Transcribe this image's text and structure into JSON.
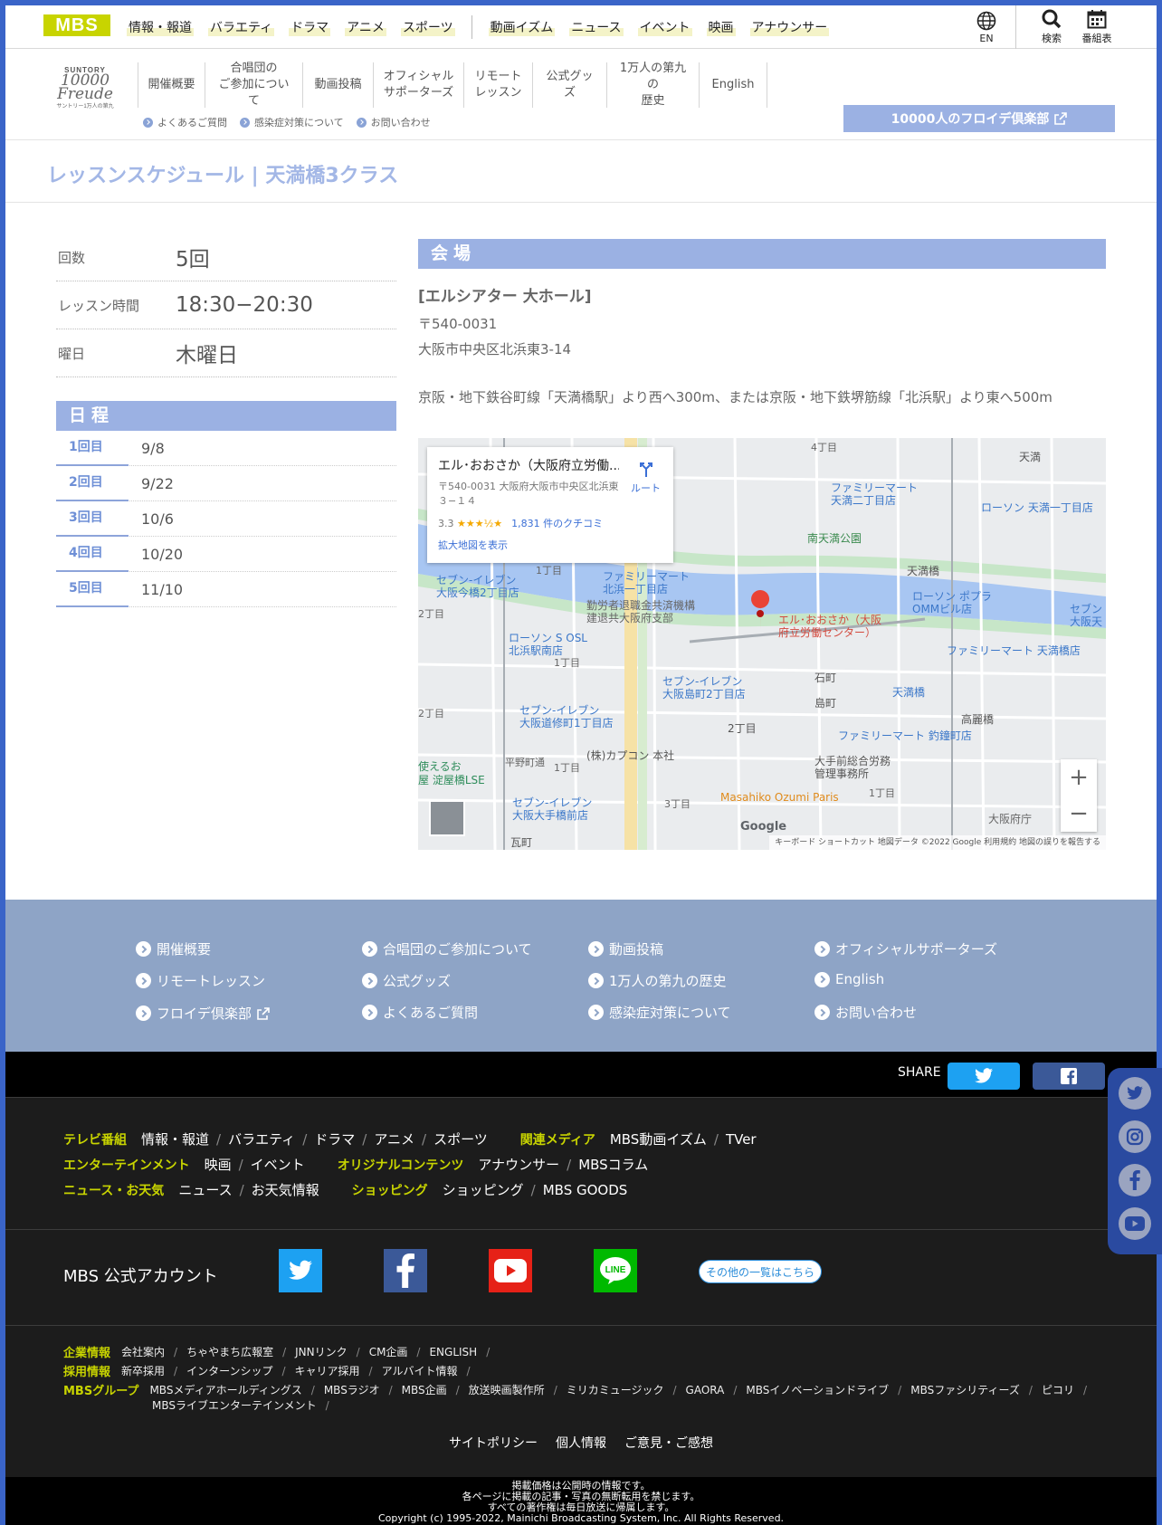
{
  "mbs_bar": {
    "logo": "MBS",
    "nav_group1": [
      "情報・報道",
      "バラエティ",
      "ドラマ",
      "アニメ",
      "スポーツ"
    ],
    "nav_group2": [
      "動画イズム",
      "ニュース",
      "イベント",
      "映画",
      "アナウンサー"
    ],
    "utilities": {
      "lang": "EN",
      "search": "検索",
      "schedule": "番組表"
    }
  },
  "freude_header": {
    "logo_brand": "SUNTORY",
    "logo_name": "10000 Freude",
    "logo_sub": "サントリー1万人の第九",
    "nav": [
      "開催概要",
      "合唱団の\nご参加について",
      "動画投稿",
      "オフィシャル\nサポーターズ",
      "リモート\nレッスン",
      "公式グッズ",
      "1万人の第九の\n歴史",
      "English"
    ],
    "sub_links": [
      "よくあるご質問",
      "感染症対策について",
      "お問い合わせ"
    ],
    "club_button": "10000人のフロイデ倶楽部"
  },
  "page_title": "レッスンスケジュール | 天満橋3クラス",
  "lesson_info": [
    {
      "label": "回数",
      "value": "5回"
    },
    {
      "label": "レッスン時間",
      "value": "18:30−20:30"
    },
    {
      "label": "曜日",
      "value": "木曜日"
    }
  ],
  "schedule": {
    "heading": "日程",
    "rows": [
      {
        "n": "1回目",
        "date": "9/8"
      },
      {
        "n": "2回目",
        "date": "9/22"
      },
      {
        "n": "3回目",
        "date": "10/6"
      },
      {
        "n": "4回目",
        "date": "10/20"
      },
      {
        "n": "5回目",
        "date": "11/10"
      }
    ]
  },
  "venue": {
    "heading": "会場",
    "name": "[エルシアター 大ホール]",
    "postal": "〒540-0031",
    "address": "大阪市中央区北浜東3-14",
    "access": "京阪・地下鉄谷町線「天満橋駅」より西へ300m、または京阪・地下鉄堺筋線「北浜駅」より東へ500m"
  },
  "map": {
    "card_title": "エル･おおさか（大阪府立労働...",
    "card_address": "〒540-0031 大阪府大阪市中央区北浜東３−１４",
    "rating": "3.3",
    "stars": "★★★½★",
    "reviews": "1,831 件のクチコミ",
    "enlarge": "拡大地図を表示",
    "route": "ルート",
    "pin_label": "エル･おおさか（大阪\n府立労働センター）",
    "labels": [
      "天満",
      "4丁目",
      "ファミリーマート\n天満二丁目店",
      "ローソン 天満一丁目店",
      "南天満公園",
      "天満橋",
      "ローソン ポプラ\nOMMビル店",
      "セブン\n大阪天",
      "ファミリーマート\n北浜一丁目店",
      "セブン-イレブン\n大阪今橋2丁目店",
      "勤労者退職金共済機構\n建退共大阪府支部",
      "ファミリーマート 天満橋店",
      "ローソン S OSL\n北浜駅南店",
      "セブン-イレブン\n大阪島町2丁目店",
      "石町",
      "島町",
      "天満橋",
      "高麗橋",
      "セブン-イレブン\n大阪道修町1丁目店",
      "2丁目",
      "ファミリーマート 釣鐘町店",
      "大手前総合労務\n管理事務所",
      "(株)カプコン 本社",
      "平野町通",
      "1丁目",
      "使えるお\n屋 淀屋橋LSE",
      "セブン-イレブン\n大阪大手橋前店",
      "3丁目",
      "Masahiko Ozumi Paris",
      "1丁目",
      "大阪府庁",
      "瓦町",
      "1丁目",
      "2丁目",
      "1丁目",
      "2丁目"
    ],
    "footer": "キーボード ショートカット   地図データ ©2022 Google   利用規約   地図の誤りを報告する",
    "google": "Google",
    "zoom_in": "+",
    "zoom_out": "−"
  },
  "footer_nav": [
    [
      "開催概要",
      "合唱団のご参加について",
      "動画投稿",
      "オフィシャルサポーターズ"
    ],
    [
      "リモートレッスン",
      "公式グッズ",
      "1万人の第九の歴史",
      "English"
    ],
    [
      "フロイデ倶楽部",
      "よくあるご質問",
      "感染症対策について",
      "お問い合わせ"
    ]
  ],
  "share": {
    "label": "SHARE"
  },
  "site_footer": {
    "rows": [
      [
        {
          "g": "テレビ番組",
          "items": [
            "情報・報道",
            "バラエティ",
            "ドラマ",
            "アニメ",
            "スポーツ"
          ]
        },
        {
          "g": "関連メディア",
          "items": [
            "MBS動画イズム",
            "TVer"
          ]
        }
      ],
      [
        {
          "g": "エンターテインメント",
          "items": [
            "映画",
            "イベント"
          ]
        },
        {
          "g": "オリジナルコンテンツ",
          "items": [
            "アナウンサー",
            "MBSコラム"
          ]
        }
      ],
      [
        {
          "g": "ニュース・お天気",
          "items": [
            "ニュース",
            "お天気情報"
          ]
        },
        {
          "g": "ショッピング",
          "items": [
            "ショッピング",
            "MBS GOODS"
          ]
        }
      ]
    ],
    "accounts_label": "MBS 公式アカウント",
    "other_list": "その他の一覧はこちら",
    "corp": [
      {
        "g": "企業情報",
        "items": [
          "会社案内",
          "ちゃやまち広報室",
          "JNNリンク",
          "CM企画",
          "ENGLISH"
        ]
      },
      {
        "g": "採用情報",
        "items": [
          "新卒採用",
          "インターンシップ",
          "キャリア採用",
          "アルバイト情報"
        ]
      },
      {
        "g": "MBSグループ",
        "items": [
          "MBSメディアホールディングス",
          "MBSラジオ",
          "MBS企画",
          "放送映画製作所",
          "ミリカミュージック",
          "GAORA",
          "MBSイノベーションドライブ",
          "MBSファシリティーズ",
          "ピコリ",
          "MBSライブエンターテインメント"
        ]
      }
    ],
    "bottom_links": [
      "サイトポリシー",
      "個人情報",
      "ご意見・ご感想"
    ]
  },
  "copyright": [
    "掲載価格は公開時の情報です。",
    "各ページに掲載の記事・写真の無断転用を禁じます。",
    "すべての著作権は毎日放送に帰属します。",
    "Copyright (c) 1995-2022, Mainichi Broadcasting System, Inc. All Rights Reserved."
  ],
  "colors": {
    "accent": "#9bb1e3",
    "mbs_green": "#c8d400",
    "footer_nav_bg": "#8ea4c6",
    "twitter": "#1da1f2",
    "facebook": "#3b5998",
    "youtube": "#e62117",
    "line": "#00b900"
  }
}
